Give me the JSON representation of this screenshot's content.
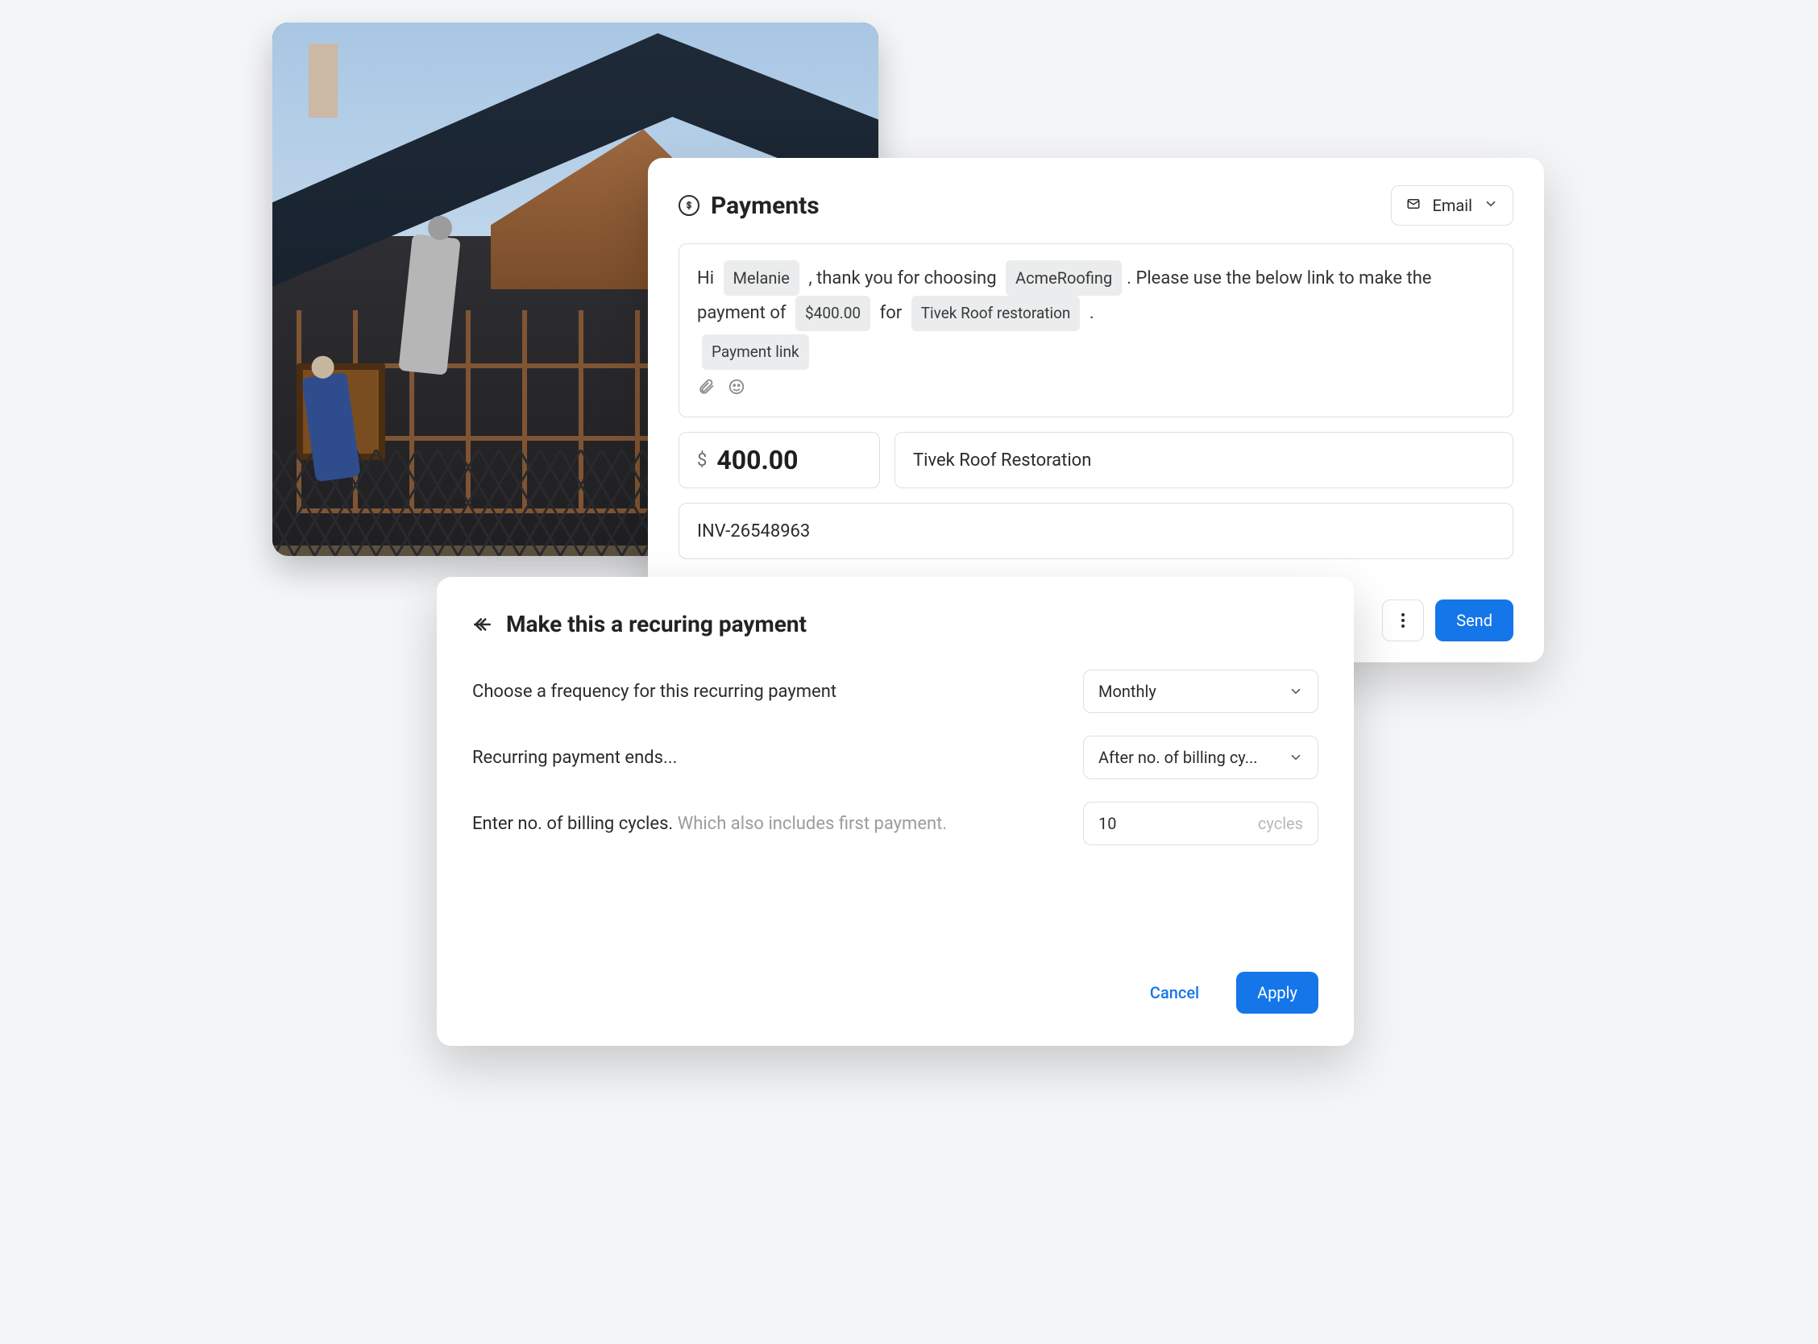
{
  "payments": {
    "title": "Payments",
    "channel": {
      "label": "Email"
    },
    "message": {
      "greeting": "Hi",
      "name_chip": "Melanie",
      "after_name": ", thank you for choosing",
      "company_chip": "AcmeRoofing",
      "after_company": ". Please use the below link to make the payment of",
      "amount_chip": "$400.00",
      "for_word": "for",
      "job_chip": "Tivek Roof restoration",
      "period": ".",
      "link_chip": "Payment link"
    },
    "amount": {
      "currency": "$",
      "value": "400.00"
    },
    "description": "Tivek Roof Restoration",
    "invoice": "INV-26548963",
    "send": "Send"
  },
  "recurring": {
    "title": "Make this a recuring payment",
    "freq_label": "Choose a frequency for this recurring payment",
    "freq_value": "Monthly",
    "ends_label": "Recurring payment ends...",
    "ends_value": "After no. of billing cy...",
    "cycles_label": "Enter no. of billing cycles.",
    "cycles_hint": "Which also includes first payment.",
    "cycles_value": "10",
    "cycles_suffix": "cycles",
    "cancel": "Cancel",
    "apply": "Apply"
  }
}
